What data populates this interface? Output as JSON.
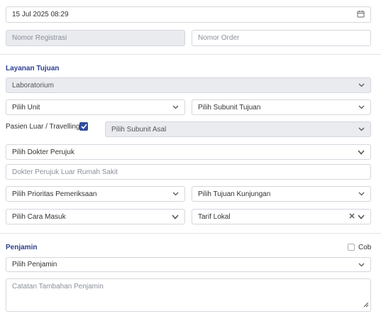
{
  "datetime": {
    "value": "15 Jul 2025 08:29",
    "icon": "calendar-icon"
  },
  "registration": {
    "placeholder": "Nomor Registrasi"
  },
  "order": {
    "placeholder": "Nomor Order"
  },
  "layanan": {
    "title": "Layanan Tujuan",
    "service": "Laboratorium",
    "unit": "Pilih Unit",
    "subunit_tujuan": "Pilih Subunit Tujuan",
    "pasien_luar_label": "Pasien Luar / Travelling",
    "pasien_luar_checked": true,
    "subunit_asal": "Pilih Subunit Asal",
    "dokter_perujuk": "Pilih Dokter Perujuk",
    "dokter_luar_placeholder": "Dokter Perujuk Luar Rumah Sakit",
    "prioritas": "Pilih Prioritas Pemeriksaan",
    "tujuan_kunjungan": "Pilih Tujuan Kunjungan",
    "cara_masuk": "Pilih Cara Masuk",
    "tarif": "Tarif Lokal"
  },
  "penjamin": {
    "title": "Penjamin",
    "cob_label": "Cob",
    "cob_checked": false,
    "select": "Pilih Penjamin",
    "notes_placeholder": "Catatan Tambahan Penjamin"
  },
  "colors": {
    "accent": "#2c3e8f",
    "checkbox": "#2f4da0",
    "disabled_bg": "#e9ebef",
    "border": "#d4d7de"
  }
}
